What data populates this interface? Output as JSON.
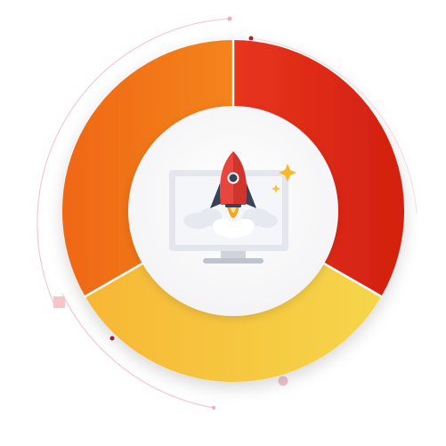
{
  "ring": {
    "segments": [
      {
        "name": "segment-top-right",
        "gradient_from": "#e8351e",
        "gradient_to": "#d2200f"
      },
      {
        "name": "segment-bottom",
        "gradient_from": "#f7b735",
        "gradient_to": "#f6d64a"
      },
      {
        "name": "segment-left",
        "gradient_from": "#f06718",
        "gradient_to": "#f3841a"
      }
    ],
    "center_fill": "#ffffff"
  },
  "decorations": {
    "orbit_line_color": "#f3c9d3",
    "dot_color": "#9b2a3a",
    "square_color": "#f7c4cc"
  },
  "icons": {
    "rocket": "rocket-icon",
    "monitor": "monitor-icon",
    "sparkle": "sparkle-icon"
  },
  "colors": {
    "rocket_body": "#e8453c",
    "rocket_window": "#3a4255",
    "rocket_flame": "#f6a623",
    "monitor_frame": "#e3e6ec",
    "monitor_screen": "#f4f6f9",
    "sparkle": "#f8b82a"
  }
}
